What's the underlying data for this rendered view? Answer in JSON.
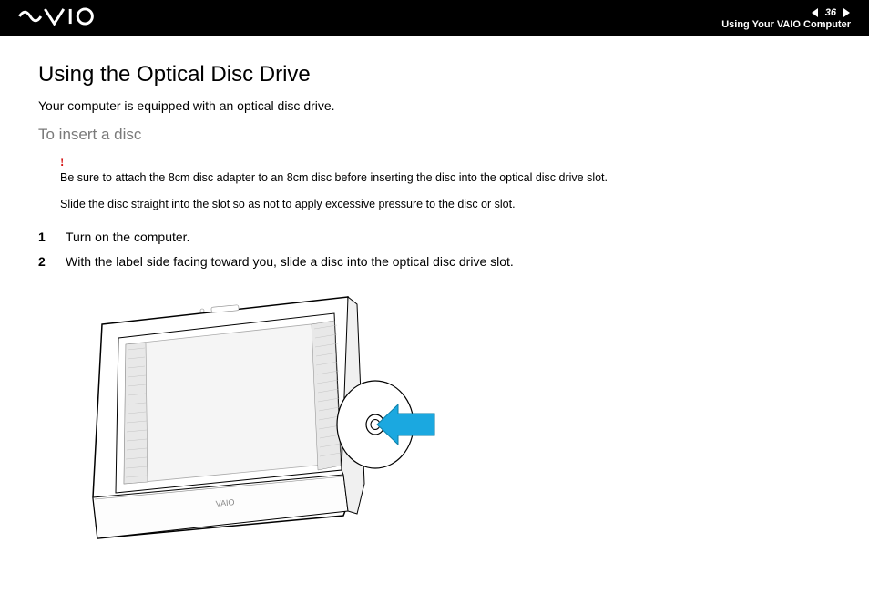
{
  "header": {
    "logo_alt": "VAIO",
    "page_number": "36",
    "subtitle": "Using Your VAIO Computer"
  },
  "title": "Using the Optical Disc Drive",
  "intro": "Your computer is equipped with an optical disc drive.",
  "section_heading": "To insert a disc",
  "warning": {
    "mark": "!",
    "line1": "Be sure to attach the 8cm disc adapter to an 8cm disc before inserting the disc into the optical disc drive slot.",
    "line2": "Slide the disc straight into the slot so as not to apply excessive pressure to the disc or slot."
  },
  "steps": [
    {
      "num": "1",
      "text": "Turn on the computer."
    },
    {
      "num": "2",
      "text": "With the label side facing toward you, slide a disc into the optical disc drive slot."
    }
  ],
  "illustration": {
    "alt": "VAIO computer with disc being inserted into optical drive slot",
    "brand_label": "VAIO"
  }
}
